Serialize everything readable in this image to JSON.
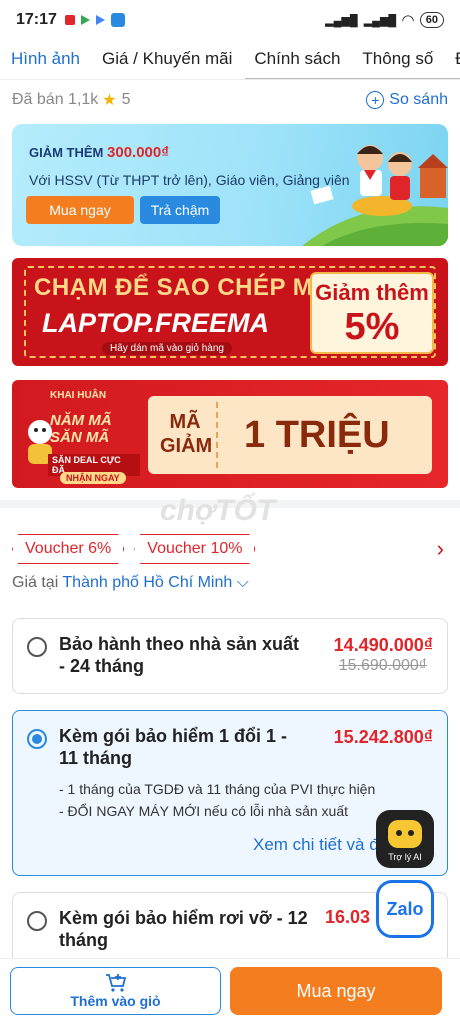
{
  "status": {
    "time": "17:17",
    "battery": "60"
  },
  "tabs": [
    {
      "label": "Hình ảnh"
    },
    {
      "label": "Giá / Khuyến mãi"
    },
    {
      "label": "Chính sách"
    },
    {
      "label": "Thông số"
    },
    {
      "label": "Đá"
    }
  ],
  "meta": {
    "sold": "Đã bán 1,1k",
    "rating": "5",
    "compare": "So sánh"
  },
  "promo": {
    "prefix": "GIẢM THÊM",
    "amount": "300.000₫",
    "desc": "Với HSSV (Từ THPT trở lên), Giáo viên, Giảng viên",
    "buy_now": "Mua ngay",
    "installment": "Trả chậm"
  },
  "banner_code": {
    "line1": "CHẠM ĐỂ SAO CHÉP MÃ",
    "code": "LAPTOP.FREEMA",
    "hint": "Hãy dán mã vào giỏ hàng",
    "discount_label": "Giảm thêm",
    "discount_value": "5%"
  },
  "banner_event": {
    "brand": "KHAI HUÂN",
    "title": "NĂM MÃ SĂN MÃ",
    "sub": "SĂN DEAL CỰC ĐÃ",
    "cta": "NHẬN NGAY",
    "code_label": "MÃ GIẢM",
    "value": "1 TRIỆU"
  },
  "watermark": "chợTỐT",
  "vouchers": [
    "Voucher 6%",
    "Voucher 10%"
  ],
  "price_at": {
    "label": "Giá tại",
    "city": "Thành phố Hồ Chí Minh"
  },
  "options": [
    {
      "title": "Bảo hành theo nhà sản xuất - 24 tháng",
      "price": "14.490.000₫",
      "old_price": "15.690.000₫"
    },
    {
      "title": "Kèm gói bảo hiểm 1 đổi 1 - 11 tháng",
      "price": "15.242.800₫",
      "bullets": [
        "- 1 tháng của TGDĐ và 11 tháng của PVI thực hiện",
        "- ĐỔI NGAY MÁY MỚI nếu có lỗi nhà sản xuất"
      ],
      "more": "Xem chi tiết và đổ"
    },
    {
      "title": "Kèm gói bảo hiểm rơi vỡ - 12 tháng",
      "price": "16.03"
    }
  ],
  "float": {
    "ai_label": "Trợ lý AI",
    "zalo": "Zalo"
  },
  "bottom": {
    "cart": "Thêm vào giỏ",
    "buy": "Mua ngay"
  }
}
